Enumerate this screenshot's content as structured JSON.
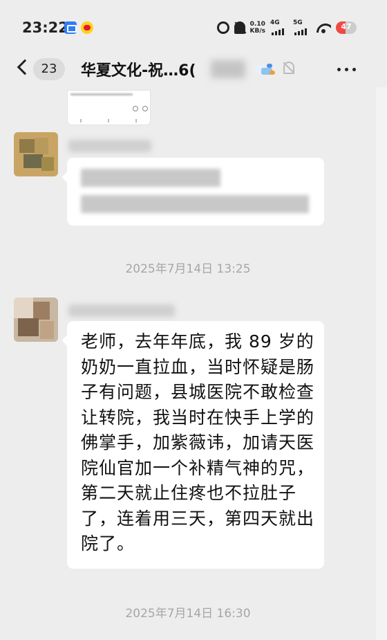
{
  "status_bar": {
    "time": "23:22",
    "net_speed_value": "0.10",
    "net_speed_unit": "KB/s",
    "sim1_label": "4G",
    "sim2_label": "5G",
    "battery_level": "47",
    "battery_color": "#f04a44"
  },
  "header": {
    "back_icon": "chevron-left-icon",
    "unread_count": "23",
    "chat_title": "华夏文化-祝…6(",
    "mute_icon": "bell-off-icon",
    "more_icon": "more-horizontal-icon"
  },
  "messages": [
    {
      "type": "timestamp",
      "text": "2025年7月14日 13:25"
    },
    {
      "type": "text",
      "text": "老师，去年年底，我 89 岁的奶奶一直拉血，当时怀疑是肠子有问题，县城医院不敢检查让转院，我当时在快手上学的佛掌手，加紫薇讳，加请天医院仙官加一个补精气神的咒，第二天就止住疼也不拉肚子了，连着用三天，第四天就出院了。"
    },
    {
      "type": "timestamp",
      "text": "2025年7月14日 16:30"
    }
  ],
  "colors": {
    "background": "#ededed",
    "bubble": "#ffffff",
    "timestamp": "#a6a6a6"
  }
}
